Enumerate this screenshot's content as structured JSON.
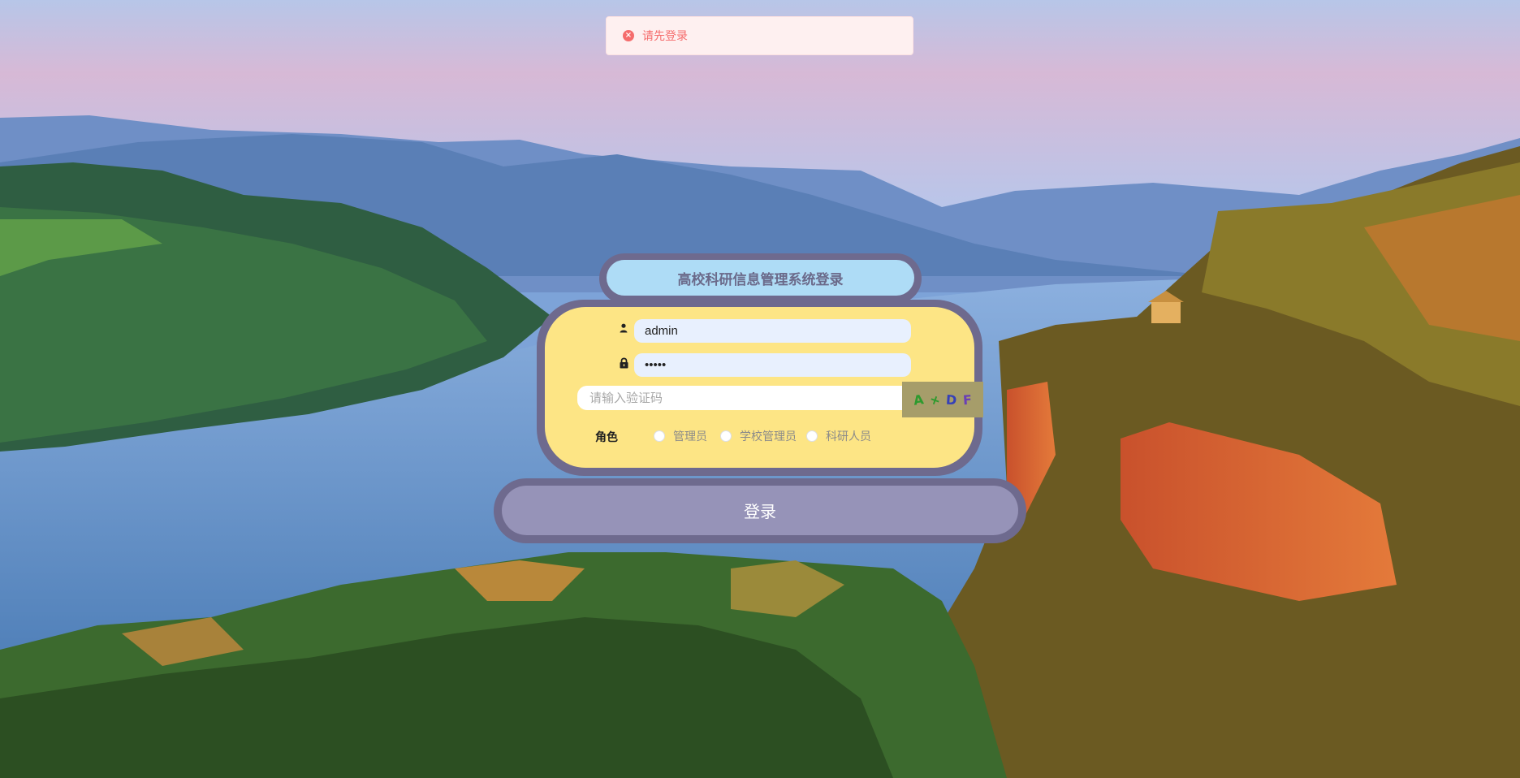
{
  "toast": {
    "icon": "close-circle-icon",
    "message": "请先登录",
    "color": "#f56c6c"
  },
  "login": {
    "title": "高校科研信息管理系统登录",
    "username": {
      "icon": "user-icon",
      "value": "admin"
    },
    "password": {
      "icon": "lock-icon",
      "value": "•••••"
    },
    "captcha": {
      "placeholder": "请输入验证码",
      "chars": [
        {
          "char": "A",
          "color": "#2e9a2e"
        },
        {
          "char": "+",
          "color": "#2e9a2e"
        },
        {
          "char": "D",
          "color": "#3540b8"
        },
        {
          "char": "F",
          "color": "#6a3fb5"
        }
      ]
    },
    "role": {
      "label": "角色",
      "options": [
        "管理员",
        "学校管理员",
        "科研人员"
      ]
    },
    "submit_label": "登录"
  },
  "colors": {
    "frame": "#6e6a8e",
    "title_bg": "#aedcf6",
    "card_bg": "#fde585",
    "button_bg": "#9693b8"
  }
}
